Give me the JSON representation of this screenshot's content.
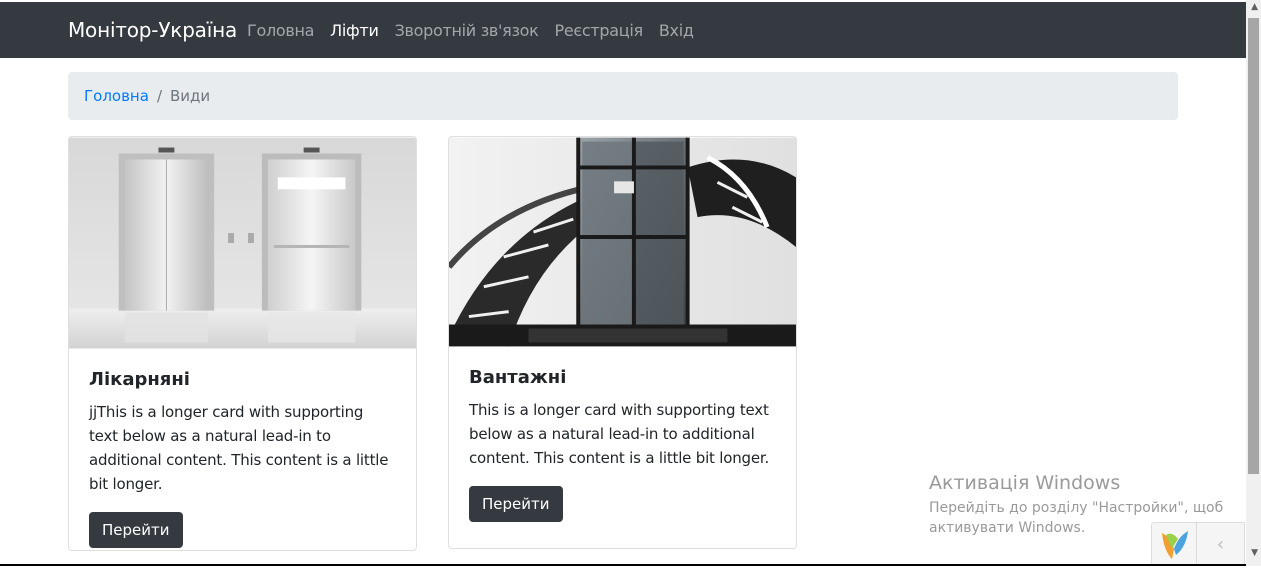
{
  "navbar": {
    "brand": "Монітор-Україна",
    "items": [
      {
        "label": "Головна",
        "active": false
      },
      {
        "label": "Ліфти",
        "active": true
      },
      {
        "label": "Зворотній зв'язок",
        "active": false
      },
      {
        "label": "Реєстрація",
        "active": false
      },
      {
        "label": "Вхід",
        "active": false
      }
    ]
  },
  "breadcrumb": {
    "home": "Головна",
    "separator": "/",
    "current": "Види"
  },
  "cards": [
    {
      "title": "Лікарняні",
      "text": "jjThis is a longer card with supporting text below as a natural lead-in to additional content. This content is a little bit longer.",
      "button": "Перейти",
      "image": "elevator-doors-image"
    },
    {
      "title": "Вантажні",
      "text": "This is a longer card with supporting text below as a natural lead-in to additional content. This content is a little bit longer.",
      "button": "Перейти",
      "image": "glass-elevator-staircase-image"
    }
  ],
  "watermark": {
    "title": "Активація Windows",
    "line1": "Перейдіть до розділу \"Настройки\", щоб",
    "line2": "активувати Windows."
  },
  "debug_toolbar": {
    "toggle_icon": "chevron-left-icon",
    "logo": "yii-logo"
  },
  "colors": {
    "navbar_bg": "#343a40",
    "link": "#007bff",
    "breadcrumb_bg": "#e9ecef",
    "button_bg": "#343a40"
  }
}
